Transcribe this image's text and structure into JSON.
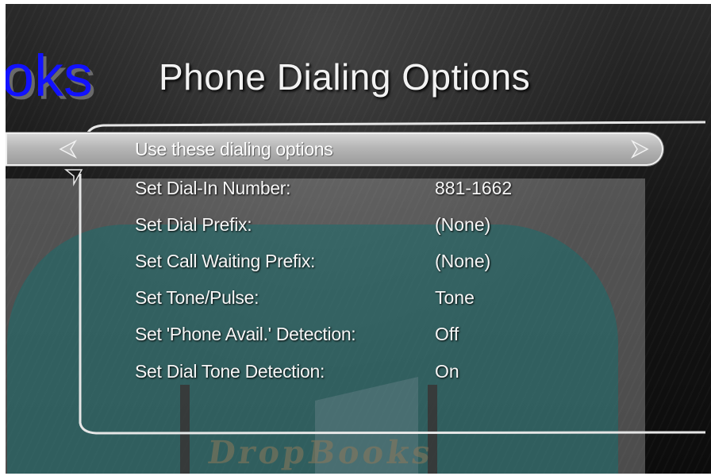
{
  "overlay_logo_text": "oks",
  "title": "Phone Dialing Options",
  "menu": {
    "selected_item": "Use these dialing options",
    "items": [
      {
        "label": "Set Dial-In Number:",
        "value": "881-1662"
      },
      {
        "label": "Set Dial Prefix:",
        "value": "(None)"
      },
      {
        "label": "Set Call Waiting Prefix:",
        "value": "(None)"
      },
      {
        "label": "Set Tone/Pulse:",
        "value": "Tone"
      },
      {
        "label": "Set 'Phone Avail.' Detection:",
        "value": "Off"
      },
      {
        "label": "Set Dial Tone Detection:",
        "value": "On"
      }
    ]
  },
  "watermark_text": "DropBooks",
  "icons": {
    "left": "left-arrow-icon",
    "right": "right-arrow-icon",
    "down": "down-arrow-icon"
  },
  "colors": {
    "overlay_text": "#1212ff",
    "watermark_teal": "#196e6e",
    "highlight": "#c2c2c2"
  }
}
